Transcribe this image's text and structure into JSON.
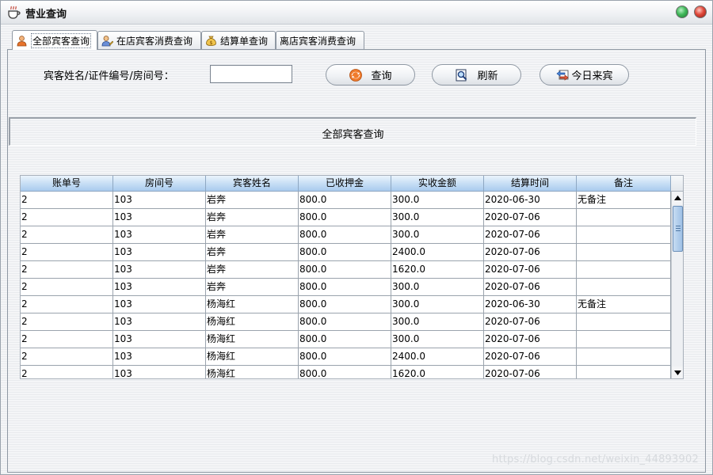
{
  "window": {
    "title": "营业查询"
  },
  "tabs": [
    {
      "label": "全部宾客查询",
      "icon": "user-icon",
      "active": true
    },
    {
      "label": "在店宾客消费查询",
      "icon": "user-edit-icon",
      "active": false
    },
    {
      "label": "结算单查询",
      "icon": "money-bag-icon",
      "active": false
    },
    {
      "label": "离店宾客消费查询",
      "icon": "",
      "active": false
    }
  ],
  "search": {
    "label": "宾客姓名/证件编号/房间号：",
    "value": "",
    "query_label": "查询",
    "refresh_label": "刷新",
    "today_label": "今日来宾"
  },
  "section": {
    "title": "全部宾客查询"
  },
  "table": {
    "columns": [
      "账单号",
      "房间号",
      "宾客姓名",
      "已收押金",
      "实收金额",
      "结算时间",
      "备注"
    ],
    "rows": [
      [
        "2",
        "103",
        "岩奔",
        "800.0",
        "300.0",
        "2020-06-30",
        "无备注"
      ],
      [
        "2",
        "103",
        "岩奔",
        "800.0",
        "300.0",
        "2020-07-06",
        ""
      ],
      [
        "2",
        "103",
        "岩奔",
        "800.0",
        "300.0",
        "2020-07-06",
        ""
      ],
      [
        "2",
        "103",
        "岩奔",
        "800.0",
        "2400.0",
        "2020-07-06",
        ""
      ],
      [
        "2",
        "103",
        "岩奔",
        "800.0",
        "1620.0",
        "2020-07-06",
        ""
      ],
      [
        "2",
        "103",
        "岩奔",
        "800.0",
        "300.0",
        "2020-07-06",
        ""
      ],
      [
        "2",
        "103",
        "杨海红",
        "800.0",
        "300.0",
        "2020-06-30",
        "无备注"
      ],
      [
        "2",
        "103",
        "杨海红",
        "800.0",
        "300.0",
        "2020-07-06",
        ""
      ],
      [
        "2",
        "103",
        "杨海红",
        "800.0",
        "300.0",
        "2020-07-06",
        ""
      ],
      [
        "2",
        "103",
        "杨海红",
        "800.0",
        "2400.0",
        "2020-07-06",
        ""
      ],
      [
        "2",
        "103",
        "杨海红",
        "800.0",
        "1620.0",
        "2020-07-06",
        ""
      ]
    ]
  },
  "watermark": "https://blog.csdn.net/weixin_44893902"
}
